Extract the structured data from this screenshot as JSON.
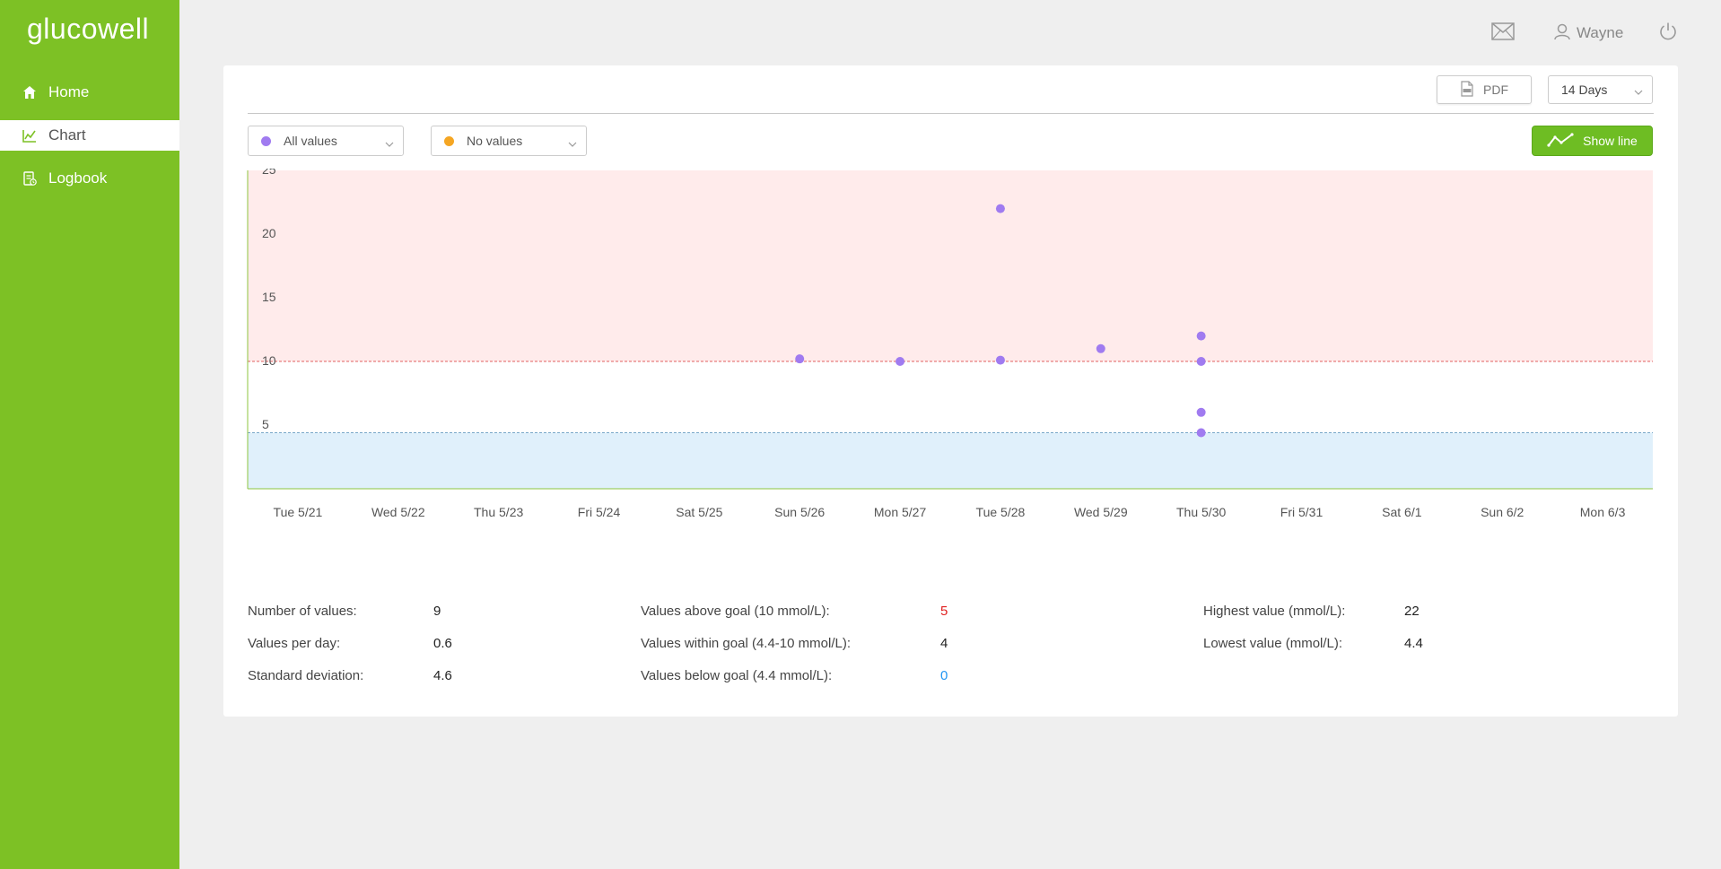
{
  "app": {
    "logo": "glucowell"
  },
  "sidebar": {
    "items": [
      {
        "label": "Home",
        "icon": "home-icon",
        "active": false
      },
      {
        "label": "Chart",
        "icon": "chart-icon",
        "active": true
      },
      {
        "label": "Logbook",
        "icon": "logbook-icon",
        "active": false
      }
    ]
  },
  "topbar": {
    "user_name": "Wayne",
    "mail_icon": "mail-icon",
    "user_icon": "user-icon",
    "power_icon": "power-icon"
  },
  "toolbar": {
    "pdf_label": "PDF",
    "range_select": "14 Days",
    "filter_primary": "All values",
    "filter_secondary": "No values",
    "show_line_label": "Show line"
  },
  "colors": {
    "brand_green": "#7dc125",
    "purple": "#a07bf0",
    "orange": "#f5a623",
    "high_zone": "#ffebeb",
    "low_zone": "#e0f0fb",
    "above_goal": "#e02020",
    "below_goal": "#2196f3"
  },
  "chart_data": {
    "type": "scatter",
    "categories": [
      "Tue 5/21",
      "Wed 5/22",
      "Thu 5/23",
      "Fri 5/24",
      "Sat 5/25",
      "Sun 5/26",
      "Mon 5/27",
      "Tue 5/28",
      "Wed 5/29",
      "Thu 5/30",
      "Fri 5/31",
      "Sat 6/1",
      "Sun 6/2",
      "Mon 6/3"
    ],
    "yticks": [
      "25",
      "20",
      "15",
      "10",
      "5"
    ],
    "ylim": [
      0,
      25
    ],
    "upper_goal": 10,
    "lower_goal": 4.4,
    "points": [
      {
        "x": "Sun 5/26",
        "y": 10.2
      },
      {
        "x": "Mon 5/27",
        "y": 10.0
      },
      {
        "x": "Tue 5/28",
        "y": 22.0
      },
      {
        "x": "Tue 5/28",
        "y": 10.1
      },
      {
        "x": "Wed 5/29",
        "y": 11.0
      },
      {
        "x": "Thu 5/30",
        "y": 12.0
      },
      {
        "x": "Thu 5/30",
        "y": 10.0
      },
      {
        "x": "Thu 5/30",
        "y": 6.0
      },
      {
        "x": "Thu 5/30",
        "y": 4.4
      }
    ]
  },
  "stats": {
    "count_label": "Number of values:",
    "count_value": "9",
    "per_day_label": "Values per day:",
    "per_day_value": "0.6",
    "stddev_label": "Standard deviation:",
    "stddev_value": "4.6",
    "above_label": "Values above goal (10 mmol/L):",
    "above_value": "5",
    "within_label": "Values within goal (4.4-10 mmol/L):",
    "within_value": "4",
    "below_label": "Values below goal (4.4 mmol/L):",
    "below_value": "0",
    "highest_label": "Highest value (mmol/L):",
    "highest_value": "22",
    "lowest_label": "Lowest value (mmol/L):",
    "lowest_value": "4.4"
  }
}
